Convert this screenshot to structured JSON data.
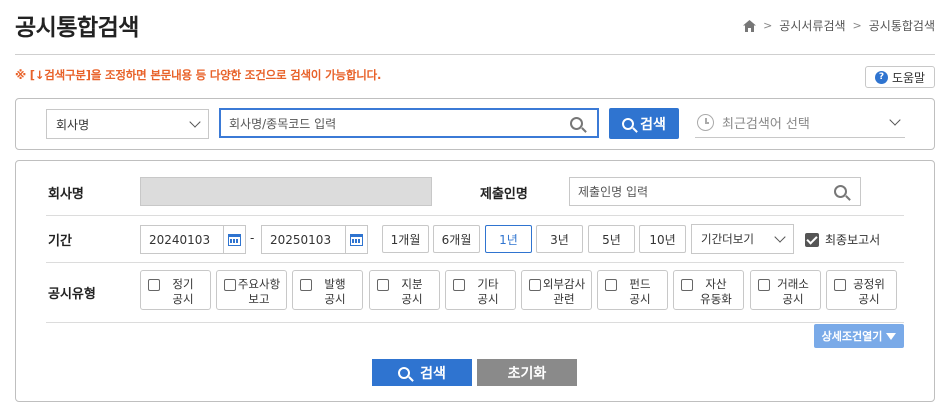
{
  "header": {
    "title": "공시통합검색",
    "breadcrumb": [
      "공시서류검색",
      "공시통합검색"
    ]
  },
  "notice": "※ [↓검색구분]을 조정하면 본문내용 등 다양한 조건으로 검색이 가능합니다.",
  "help_label": "도움말",
  "search": {
    "type_selected": "회사명",
    "input_placeholder": "회사명/종목코드 입력",
    "button_label": "검색",
    "recent_placeholder": "최근검색어 선택"
  },
  "conditions": {
    "company_label": "회사명",
    "submitter_label": "제출인명",
    "submitter_placeholder": "제출인명 입력",
    "period_label": "기간",
    "date_start": "20240103",
    "date_sep": "-",
    "date_end": "20250103",
    "periods": [
      "1개월",
      "6개월",
      "1년",
      "3년",
      "5년",
      "10년"
    ],
    "period_active": "1년",
    "period_more": "기간더보기",
    "final_report_label": "최종보고서",
    "final_report_checked": true,
    "type_label": "공시유형",
    "types": [
      [
        "정기",
        "공시"
      ],
      [
        "주요사항",
        "보고"
      ],
      [
        "발행",
        "공시"
      ],
      [
        "지분",
        "공시"
      ],
      [
        "기타",
        "공시"
      ],
      [
        "외부감사",
        "관련"
      ],
      [
        "펀드",
        "공시"
      ],
      [
        "자산",
        "유동화"
      ],
      [
        "거래소",
        "공시"
      ],
      [
        "공정위",
        "공시"
      ]
    ],
    "detail_toggle": "상세조건열기"
  },
  "actions": {
    "search_label": "검색",
    "reset_label": "초기화"
  },
  "colors": {
    "accent": "#2f74d0",
    "notice": "#e8622a",
    "detail": "#7aaae8"
  }
}
